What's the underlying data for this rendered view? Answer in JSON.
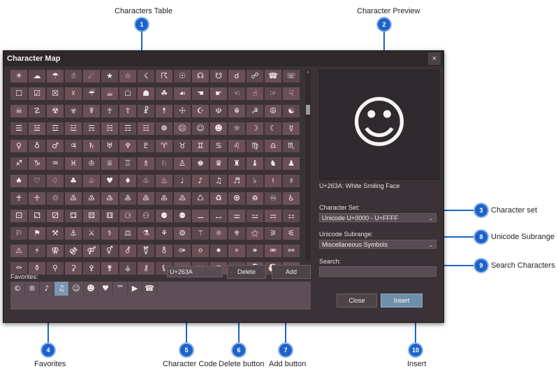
{
  "callouts": [
    {
      "num": "1",
      "label": "Characters Table"
    },
    {
      "num": "2",
      "label": "Character Preview"
    },
    {
      "num": "3",
      "label": "Character set"
    },
    {
      "num": "8",
      "label": "Unicode Subrange"
    },
    {
      "num": "9",
      "label": "Search Characters"
    },
    {
      "num": "4",
      "label": "Favorites"
    },
    {
      "num": "5",
      "label": "Character Code"
    },
    {
      "num": "6",
      "label": "Delete button"
    },
    {
      "num": "7",
      "label": "Add button"
    },
    {
      "num": "10",
      "label": "Insert"
    }
  ],
  "dialog": {
    "title": "Character Map",
    "close_glyph": "×",
    "grid_rows": [
      [
        "☀",
        "☁",
        "☂",
        "☃",
        "☄",
        "★",
        "☆",
        "☇",
        "☈",
        "☉",
        "☊",
        "☋",
        "☌",
        "☍",
        "☎",
        "☏"
      ],
      [
        "☐",
        "☑",
        "☒",
        "☓",
        "☔",
        "☕",
        "☖",
        "☗",
        "☘",
        "☙",
        "☚",
        "☛",
        "☜",
        "☝",
        "☞",
        "☟"
      ],
      [
        "☠",
        "☡",
        "☢",
        "☣",
        "☤",
        "☥",
        "☦",
        "☧",
        "☨",
        "☩",
        "☪",
        "☫",
        "☬",
        "☭",
        "☮",
        "☯"
      ],
      [
        "☰",
        "☱",
        "☲",
        "☳",
        "☴",
        "☵",
        "☶",
        "☷",
        "☸",
        "☹",
        "☺",
        "☻",
        "☼",
        "☽",
        "☾",
        "☿"
      ],
      [
        "♀",
        "♁",
        "♂",
        "♃",
        "♄",
        "♅",
        "♆",
        "♇",
        "♈",
        "♉",
        "♊",
        "♋",
        "♌",
        "♍",
        "♎",
        "♏"
      ],
      [
        "♐",
        "♑",
        "♒",
        "♓",
        "♔",
        "♕",
        "♖",
        "♗",
        "♘",
        "♙",
        "♚",
        "♛",
        "♜",
        "♝",
        "♞",
        "♟"
      ],
      [
        "♠",
        "♡",
        "♢",
        "♣",
        "♤",
        "♥",
        "♦",
        "♧",
        "♨",
        "♩",
        "♪",
        "♫",
        "♬",
        "♭",
        "♮",
        "♯"
      ],
      [
        "♰",
        "♱",
        "♲",
        "♳",
        "♴",
        "♵",
        "♶",
        "♷",
        "♸",
        "♹",
        "♺",
        "♻",
        "♼",
        "♽",
        "♾",
        "♿"
      ],
      [
        "⚀",
        "⚁",
        "⚂",
        "⚃",
        "⚄",
        "⚅",
        "⚆",
        "⚇",
        "⚈",
        "⚉",
        "⚊",
        "⚋",
        "⚌",
        "⚍",
        "⚎",
        "⚏"
      ],
      [
        "⚐",
        "⚑",
        "⚒",
        "⚓",
        "⚔",
        "⚕",
        "⚖",
        "⚗",
        "⚘",
        "⚙",
        "⚚",
        "⚛",
        "⚜",
        "⚝",
        "⚞",
        "⚟"
      ],
      [
        "⚠",
        "⚡",
        "⚢",
        "⚣",
        "⚤",
        "⚥",
        "⚦",
        "⚧",
        "⚨",
        "⚩",
        "⚪",
        "⚫",
        "⚬",
        "⚭",
        "⚮",
        "⚯"
      ],
      [
        "⚰",
        "⚱",
        "⚲",
        "⚳",
        "⚴",
        "⚵",
        "⚶",
        "⚷",
        "⚸",
        "⚹",
        "⚺",
        "⚻",
        "⚼",
        "⚽",
        "⚾",
        "⚿"
      ]
    ],
    "preview_glyph": "☺",
    "preview_caption": "U+263A: White Smiling Face",
    "charset_label": "Character Set:",
    "charset_value": "Unicode U+0000 - U+FFFF",
    "subrange_label": "Unicode Subrange:",
    "subrange_value": "Miscellaneous Symbols",
    "search_label": "Search:",
    "search_value": "",
    "favorites_label": "Favorites:",
    "favorites": [
      "©",
      "®",
      "♪",
      "♫",
      "☺",
      "☻",
      "♥",
      "™",
      "▶",
      "☎"
    ],
    "char_code": "U+263A",
    "delete_label": "Delete",
    "add_label": "Add",
    "close_label": "Close",
    "insert_label": "Insert",
    "dropdown_glyph": "⌄",
    "scroll_up_glyph": "˄",
    "scroll_down_glyph": "˅"
  }
}
